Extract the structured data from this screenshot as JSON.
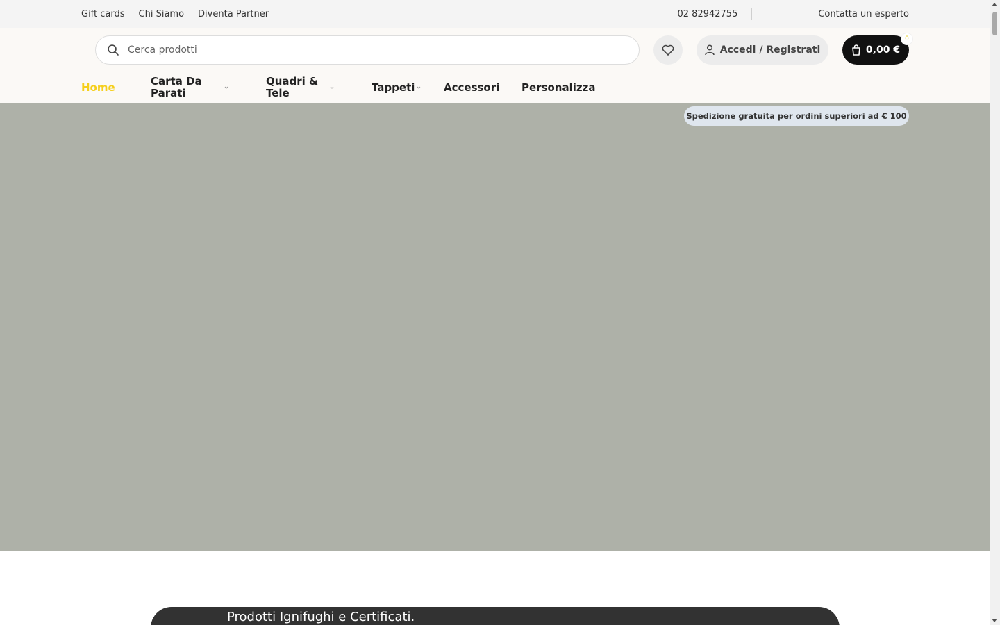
{
  "topbar": {
    "links": [
      "Gift cards",
      "Chi Siamo",
      "Diventa Partner"
    ],
    "phone": "02 82942755",
    "contact": "Contatta un esperto"
  },
  "header": {
    "search_placeholder": "Cerca prodotti",
    "account_label": "Accedi / Registrati",
    "cart_total": "0,00 €",
    "cart_count": "0"
  },
  "nav": {
    "items": [
      {
        "label": "Home",
        "active": true
      },
      {
        "label": "Carta Da Parati",
        "has_dropdown": true
      },
      {
        "label": "Quadri & Tele",
        "has_dropdown": true
      },
      {
        "label": "Tappeti",
        "has_dropdown": true
      },
      {
        "label": "Accessori"
      },
      {
        "label": "Personalizza"
      }
    ],
    "shipping_notice": "Spedizione gratuita per ordini superiori ad € 100"
  },
  "hero": {
    "background_color": "#aeb1a8"
  },
  "banner": {
    "text": "Prodotti Ignifughi e Certificati."
  },
  "colors": {
    "accent": "#f5cf1b",
    "cart_bg": "#111111",
    "shipping_pill_bg": "#dfe6ee"
  }
}
